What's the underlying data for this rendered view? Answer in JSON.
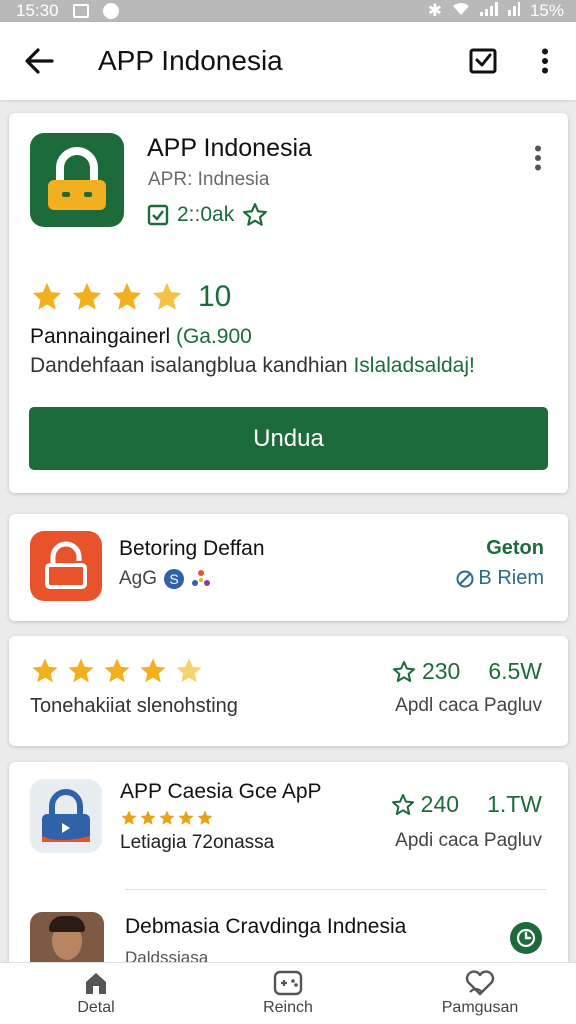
{
  "status_bar": {
    "time": "15:30",
    "battery": "15%"
  },
  "appbar": {
    "title": "APP Indonesia"
  },
  "main_app": {
    "name": "APP Indonesia",
    "publisher": "APR: Indnesia",
    "downloads": "2::0ak",
    "rating": "10",
    "stars": 4,
    "info_label": "Pannaingainerl",
    "info_value": "(Ga.900",
    "description": "Dandehfaan isalangblua kandhian",
    "description_link": "Islaladsaldaj!",
    "install_label": "Undua"
  },
  "card_b": {
    "name": "Betoring Deffan",
    "sub": "AgG",
    "status": "Geton",
    "sub_right": "B Riem"
  },
  "card_c": {
    "stars": 4,
    "label": "Tonehakiiat slenohsting",
    "count": "230",
    "size": "6.5W",
    "sub": "Apdl caca Pagluv"
  },
  "card_d": {
    "name": "APP Caesia Gce ApP",
    "stars": 5,
    "developer": "Letiagia 72onassa",
    "count": "240",
    "size": "1.TW",
    "sub": "Apdi caca Pagluv",
    "item2_name": "Debmasia Cravdinga Indnesia",
    "item2_sub": "Daldssiasa"
  },
  "bottom_nav": [
    {
      "label": "Detal",
      "icon": "home-icon"
    },
    {
      "label": "Reinch",
      "icon": "game-controller-icon"
    },
    {
      "label": "Pamgusan",
      "icon": "heart-icon"
    }
  ],
  "colors": {
    "primary": "#1d6b3b",
    "star": "#f2b01e",
    "orange": "#e8532c",
    "blue": "#2f62a8"
  }
}
